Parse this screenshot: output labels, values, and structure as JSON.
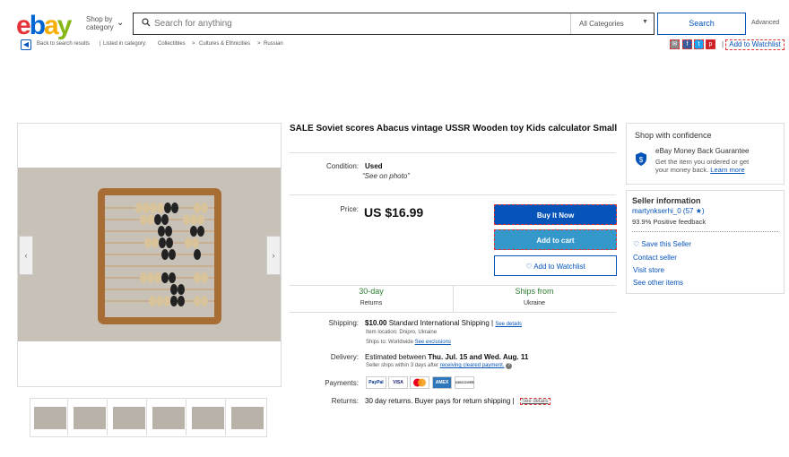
{
  "header": {
    "logo": {
      "e": "e",
      "b": "b",
      "a": "a",
      "y": "y"
    },
    "shop_by_line1": "Shop by",
    "shop_by_line2": "category",
    "search_placeholder": "Search for anything",
    "category_select": "All Categories",
    "search_button": "Search",
    "advanced": "Advanced"
  },
  "breadcrumb": {
    "back": "Back to search results",
    "listed": "Listed in category:",
    "crumbs": [
      "Collectibles",
      "Cultures & Ethnicities",
      "Russian"
    ],
    "sep": ">",
    "share_icons": [
      "email-icon",
      "facebook-icon",
      "twitter-icon",
      "pinterest-icon"
    ],
    "add_watchlist": "Add to Watchlist"
  },
  "listing": {
    "title": "SALE Soviet scores Abacus vintage USSR Wooden toy Kids calculator Small",
    "condition_label": "Condition:",
    "condition_value": "Used",
    "condition_note": "See on photo",
    "price_label": "Price:",
    "price": "US $16.99",
    "buy_now": "Buy It Now",
    "add_to_cart": "Add to cart",
    "add_to_watchlist": "Add to Watchlist",
    "returns_days": "30-day",
    "returns_sub": "Returns",
    "ships_from": "Ships from",
    "ships_from_sub": "Ukraine",
    "shipping_label": "Shipping:",
    "shipping_cost": "$10.00",
    "shipping_method": "Standard International Shipping",
    "see_details": "See details",
    "item_location": "Item location:  Dnipro, Ukraine",
    "ships_to_label": "Ships to:  Worldwide",
    "see_exclusions": "See exclusions",
    "delivery_label": "Delivery:",
    "delivery_text": "Estimated between",
    "delivery_dates": "Thu. Jul. 15 and Wed. Aug. 11",
    "delivery_note": "Seller ships within 3 days after",
    "cleared_payment": "receiving cleared payment.",
    "payments_label": "Payments:",
    "payment_methods": [
      "PayPal",
      "VISA",
      "MC",
      "AMEX",
      "DISCOVER"
    ],
    "returns_label": "Returns:",
    "returns_text": "30 day returns. Buyer pays for return shipping |",
    "returns_see_details": "See details"
  },
  "confidence": {
    "heading": "Shop with confidence",
    "guarantee_title": "eBay Money Back Guarantee",
    "guarantee_text1": "Get the item you ordered or get",
    "guarantee_text2": "your money back.",
    "learn_more": "Learn more"
  },
  "seller": {
    "heading": "Seller information",
    "name": "martynkserhi_0 (57 ★)",
    "feedback": "93.9% Positive feedback",
    "save": "Save this Seller",
    "contact": "Contact seller",
    "store": "Visit store",
    "other_items": "See other items"
  },
  "colors": {
    "brand_blue": "#0654ba",
    "cart_blue": "#3498ca",
    "green": "#2d7d32"
  }
}
